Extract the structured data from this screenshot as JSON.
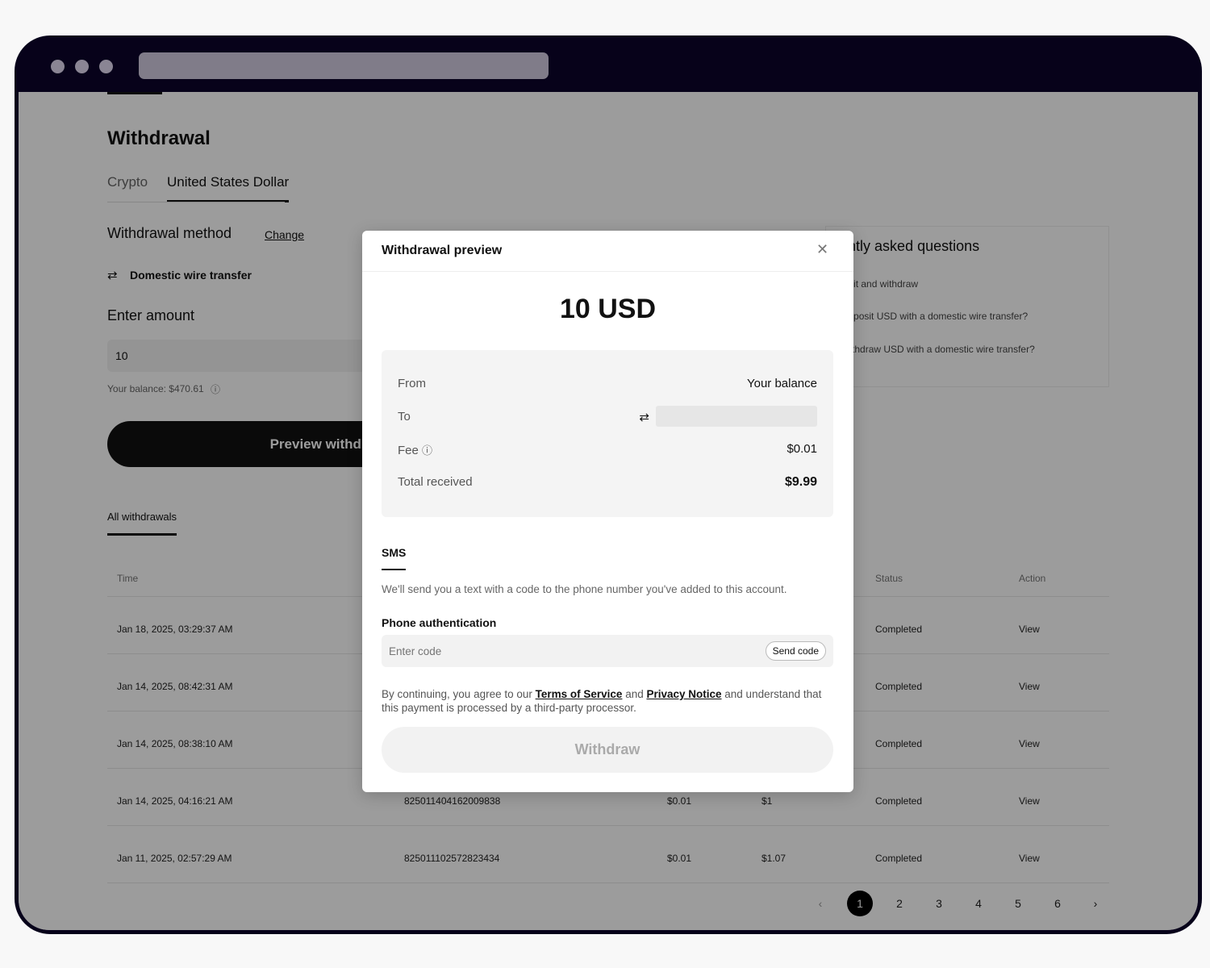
{
  "page": {
    "title": "Withdrawal",
    "tabs": [
      {
        "label": "Crypto"
      },
      {
        "label": "United States Dollar",
        "active": true
      }
    ],
    "method_label": "Withdrawal method",
    "change_label": "Change",
    "method": "Domestic wire transfer",
    "amount_label": "Enter amount",
    "amount_value": "10",
    "balance": "Your balance: $470.61",
    "preview_button": "Preview withdrawal",
    "history_tab": "All withdrawals",
    "faq": {
      "title": "Frequently asked questions",
      "items": [
        "Cash deposit and withdraw",
        "How do I deposit USD with a domestic wire transfer?",
        "How do I withdraw USD with a domestic wire transfer?"
      ]
    },
    "table": {
      "headers": {
        "time": "Time",
        "status": "Status",
        "action": "Action"
      },
      "rows": [
        {
          "time": "Jan 18, 2025, 03:29:37 AM",
          "id": "",
          "fee": "",
          "amount": "",
          "status": "Completed",
          "action": "View"
        },
        {
          "time": "Jan 14, 2025, 08:42:31 AM",
          "id": "",
          "fee": "",
          "amount": "",
          "status": "Completed",
          "action": "View"
        },
        {
          "time": "Jan 14, 2025, 08:38:10 AM",
          "id": "",
          "fee": "",
          "amount": "",
          "status": "Completed",
          "action": "View"
        },
        {
          "time": "Jan 14, 2025, 04:16:21 AM",
          "id": "825011404162009838",
          "fee": "$0.01",
          "amount": "$1",
          "status": "Completed",
          "action": "View"
        },
        {
          "time": "Jan 11, 2025, 02:57:29 AM",
          "id": "825011102572823434",
          "fee": "$0.01",
          "amount": "$1.07",
          "status": "Completed",
          "action": "View"
        }
      ]
    },
    "pagination": {
      "pages": [
        "1",
        "2",
        "3",
        "4",
        "5",
        "6"
      ],
      "current": "1",
      "prev": "‹",
      "next": "›"
    }
  },
  "modal": {
    "title": "Withdrawal preview",
    "close": "✕",
    "amount": "10 USD",
    "from_label": "From",
    "from_value": "Your balance",
    "to_label": "To",
    "fee_label": "Fee",
    "fee_value": "$0.01",
    "total_label": "Total received",
    "total_value": "$9.99",
    "sms_tab": "SMS",
    "sms_desc": "We'll send you a text with a code to the phone number you've added to this account.",
    "phone_label": "Phone authentication",
    "code_placeholder": "Enter code",
    "send_code": "Send code",
    "terms_pre": "By continuing, you agree to our ",
    "terms_link": "Terms of Service",
    "terms_and": " and ",
    "privacy_link": "Privacy Notice",
    "terms_post": " and understand that this payment is processed by a third-party processor.",
    "withdraw": "Withdraw"
  }
}
